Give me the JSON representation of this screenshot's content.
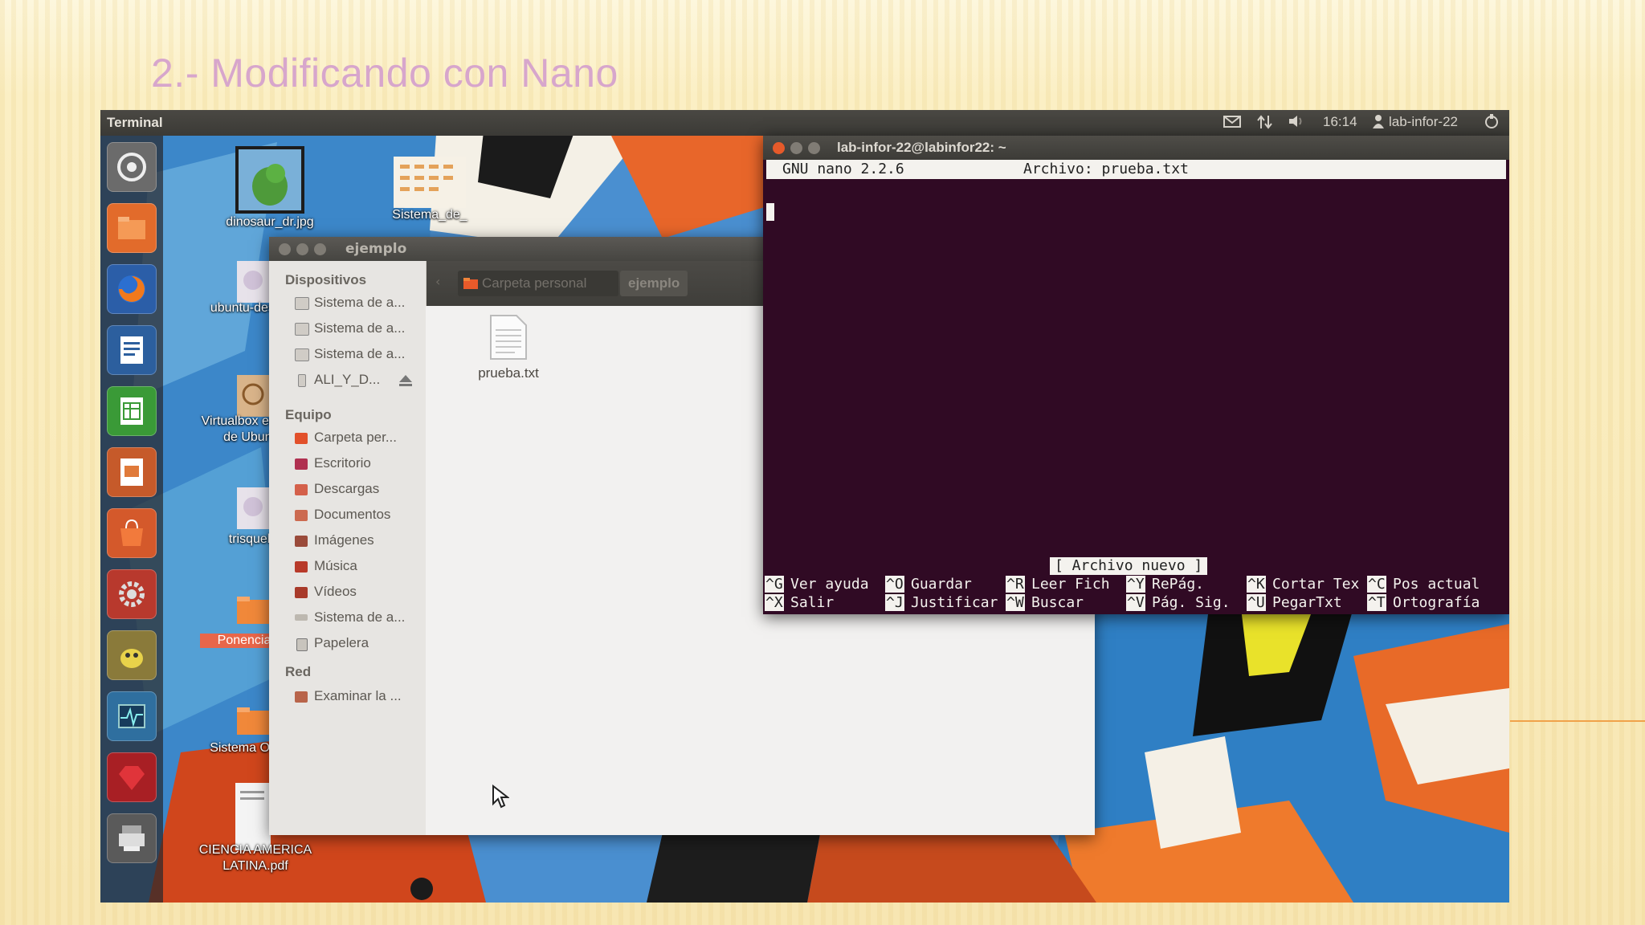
{
  "slide": {
    "title": "2.- Modificando con Nano"
  },
  "top_panel": {
    "app_title": "Terminal",
    "indicators": [
      {
        "name": "mail-icon"
      },
      {
        "name": "network-icon"
      },
      {
        "name": "volume-icon"
      }
    ],
    "clock": "16:14",
    "user": "lab-infor-22"
  },
  "launcher": {
    "items": [
      "dash-icon",
      "files-icon",
      "firefox-icon",
      "writer-icon",
      "calc-icon",
      "impress-icon",
      "software-center-icon",
      "settings-icon",
      "gimp-icon",
      "system-monitor-icon",
      "ruby-icon",
      "scanner-icon"
    ]
  },
  "desktop": {
    "icons": [
      {
        "label": "dinosaur_dr.jpg"
      },
      {
        "label": "Sistema_de_"
      },
      {
        "label": "ubuntu-desktop"
      },
      {
        "label": "Virtualbox en Dr Ir de Ubuntu"
      },
      {
        "label": "trisquel_"
      },
      {
        "label": "Ponencia"
      },
      {
        "label": "Sistema Op"
      },
      {
        "label": "CIENCIA AMERICA LATINA.pdf"
      }
    ]
  },
  "file_manager": {
    "title": "ejemplo",
    "breadcrumb": [
      "Carpeta personal",
      "ejemplo"
    ],
    "sidebar": {
      "devices_header": "Dispositivos",
      "devices": [
        "Sistema de a...",
        "Sistema de a...",
        "Sistema de a...",
        "ALI_Y_D..."
      ],
      "computer_header": "Equipo",
      "computer": [
        "Carpeta per...",
        "Escritorio",
        "Descargas",
        "Documentos",
        "Imágenes",
        "Música",
        "Vídeos",
        "Sistema de a...",
        "Papelera"
      ],
      "network_header": "Red",
      "network": [
        "Examinar la ..."
      ]
    },
    "files": [
      {
        "name": "prueba.txt"
      }
    ]
  },
  "terminal": {
    "title": "lab-infor-22@labinfor22: ~",
    "nano_version": "GNU nano 2.2.6",
    "file_label": "Archivo: prueba.txt",
    "status": "[ Archivo nuevo ]",
    "shortcuts_row1": [
      {
        "key": "^G",
        "label": "Ver ayuda"
      },
      {
        "key": "^O",
        "label": "Guardar"
      },
      {
        "key": "^R",
        "label": "Leer Fich"
      },
      {
        "key": "^Y",
        "label": "RePág."
      },
      {
        "key": "^K",
        "label": "Cortar Tex"
      },
      {
        "key": "^C",
        "label": "Pos actual"
      }
    ],
    "shortcuts_row2": [
      {
        "key": "^X",
        "label": "Salir"
      },
      {
        "key": "^J",
        "label": "Justificar"
      },
      {
        "key": "^W",
        "label": "Buscar"
      },
      {
        "key": "^V",
        "label": "Pág. Sig."
      },
      {
        "key": "^U",
        "label": "PegarTxt"
      },
      {
        "key": "^T",
        "label": "Ortografía"
      }
    ]
  },
  "colors": {
    "terminal_bg": "#300a24",
    "ubuntu_orange": "#e95420",
    "title_color": "#d7a6cc"
  }
}
